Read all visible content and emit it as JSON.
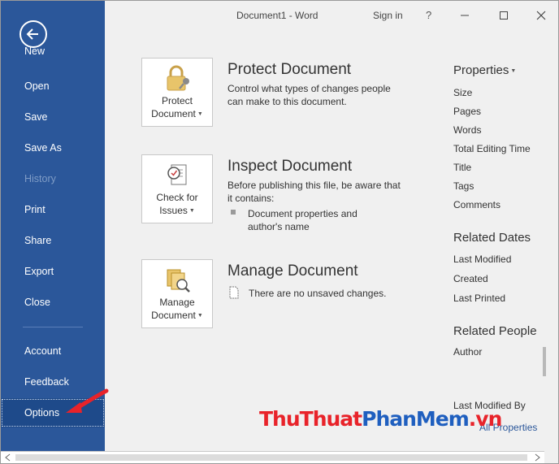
{
  "window": {
    "title": "Document1  -  Word",
    "sign_in": "Sign in",
    "help": "?"
  },
  "sidebar": {
    "items": [
      {
        "label": "New"
      },
      {
        "label": "Open"
      },
      {
        "label": "Save"
      },
      {
        "label": "Save As"
      },
      {
        "label": "History"
      },
      {
        "label": "Print"
      },
      {
        "label": "Share"
      },
      {
        "label": "Export"
      },
      {
        "label": "Close"
      },
      {
        "label": "Account"
      },
      {
        "label": "Feedback"
      },
      {
        "label": "Options"
      }
    ]
  },
  "sections": {
    "protect": {
      "button_line1": "Protect",
      "button_line2": "Document",
      "title": "Protect Document",
      "desc": "Control what types of changes people can make to this document."
    },
    "inspect": {
      "button_line1": "Check for",
      "button_line2": "Issues",
      "title": "Inspect Document",
      "desc": "Before publishing this file, be aware that it contains:",
      "bullet_line1": "Document properties and",
      "bullet_line2": "author's name"
    },
    "manage": {
      "button_line1": "Manage",
      "button_line2": "Document",
      "title": "Manage Document",
      "note": "There are no unsaved changes."
    }
  },
  "properties": {
    "title": "Properties",
    "items": [
      "Size",
      "Pages",
      "Words",
      "Total Editing Time",
      "Title",
      "Tags",
      "Comments"
    ],
    "related_dates_title": "Related Dates",
    "related_dates": [
      "Last Modified",
      "Created",
      "Last Printed"
    ],
    "related_people_title": "Related People",
    "related_people": [
      "Author"
    ],
    "last_modified_by": "Last Modified By",
    "show_all": "All Properties"
  },
  "watermark": {
    "part1": "ThuThuat",
    "part2": "PhanMem",
    "part3": ".vn"
  },
  "colors": {
    "sidebar": "#2b579a",
    "watermark_red": "#e8232a",
    "watermark_blue": "#1f5fbf",
    "annotation_arrow": "#e8232a"
  }
}
